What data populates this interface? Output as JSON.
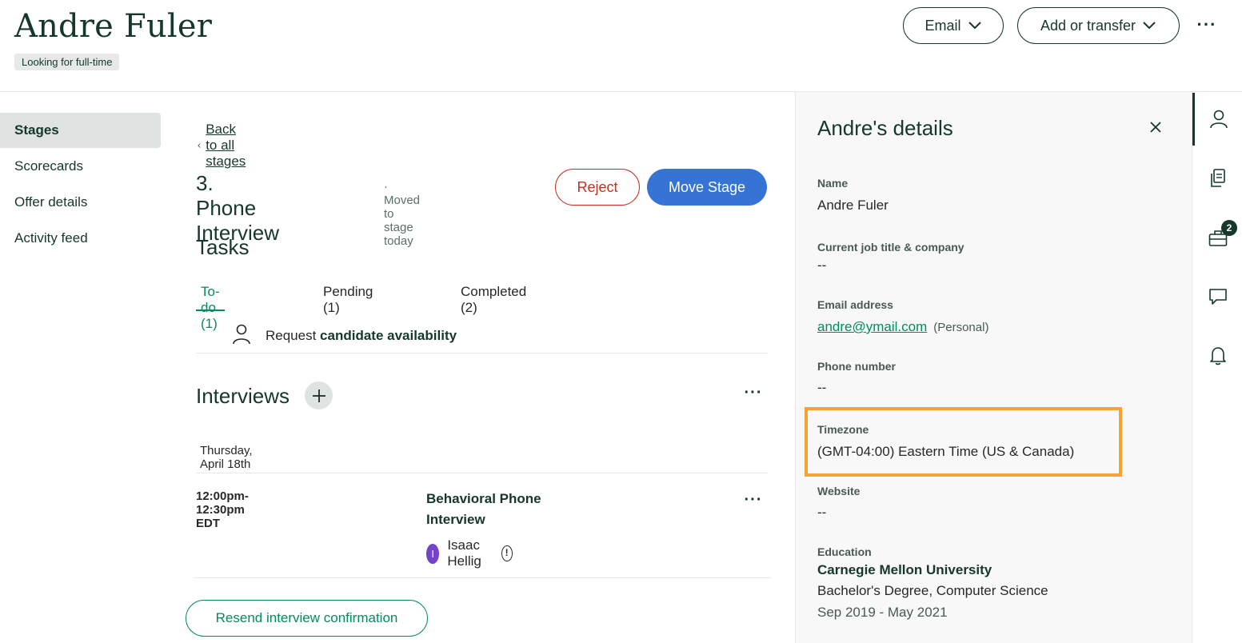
{
  "header": {
    "candidate_name": "Andre Fuler",
    "status_tag": "Looking for full-time",
    "email_label": "Email",
    "add_transfer_label": "Add or transfer",
    "more_icon": "more-horizontal-icon"
  },
  "sidenav": {
    "items": [
      {
        "label": "Stages",
        "active": true
      },
      {
        "label": "Scorecards",
        "active": false
      },
      {
        "label": "Offer details",
        "active": false
      },
      {
        "label": "Activity feed",
        "active": false
      }
    ]
  },
  "stage": {
    "back_label": "Back to all stages",
    "title": "3. Phone Interview",
    "meta": "· Moved to stage today",
    "reject_label": "Reject",
    "move_label": "Move Stage"
  },
  "tasks": {
    "title": "Tasks",
    "tabs": [
      {
        "label": "To-do (1)",
        "active": true
      },
      {
        "label": "Pending (1)",
        "active": false
      },
      {
        "label": "Completed (2)",
        "active": false
      }
    ],
    "item": {
      "prefix": "Request ",
      "bold": "candidate availability"
    }
  },
  "interviews": {
    "title": "Interviews",
    "date": "Thursday, April 18th",
    "time": "12:00pm-12:30pm EDT",
    "name": "Behavioral Phone Interview",
    "interviewer_initial": "I",
    "interviewer": "Isaac Hellig",
    "info_glyph": "!",
    "resend_label": "Resend interview confirmation"
  },
  "details": {
    "title": "Andre's details",
    "name_label": "Name",
    "name_value": "Andre Fuler",
    "job_label": "Current job title & company",
    "job_value": "--",
    "email_label": "Email address",
    "email_value": "andre@ymail.com",
    "email_type": "(Personal)",
    "phone_label": "Phone number",
    "phone_value": "--",
    "timezone_label": "Timezone",
    "timezone_value": "(GMT-04:00) Eastern Time (US & Canada)",
    "website_label": "Website",
    "website_value": "--",
    "education_label": "Education",
    "education_school": "Carnegie Mellon University",
    "education_degree": "Bachelor's Degree, Computer Science",
    "education_dates": "Sep 2019 - May 2021"
  },
  "rail": {
    "badge_count": "2"
  },
  "colors": {
    "brand_dark": "#15372c",
    "accent_green": "#048a5f",
    "primary_blue": "#3574d4",
    "reject_red": "#c5301f",
    "highlight_orange": "#f6a431"
  }
}
